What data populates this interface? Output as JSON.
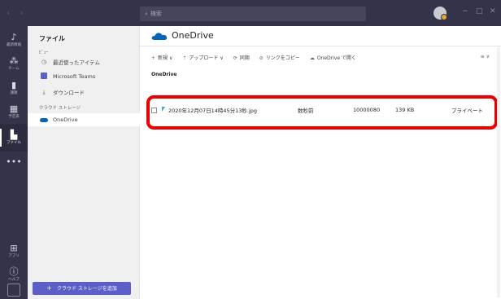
{
  "titlebar": {
    "search_placeholder": "検索",
    "back_glyph": "‹",
    "forward_glyph": "›",
    "minimize_glyph": "−",
    "restore_glyph": "□",
    "close_glyph": "✕"
  },
  "rail": {
    "items": [
      {
        "label": "最新情報",
        "icon": "bell-icon",
        "glyph": "🔔"
      },
      {
        "label": "チーム",
        "icon": "teams-icon",
        "glyph": "👥"
      },
      {
        "label": "課題",
        "icon": "assignments-icon",
        "glyph": "📋"
      },
      {
        "label": "予定表",
        "icon": "calendar-icon",
        "glyph": "📅"
      },
      {
        "label": "ファイル",
        "icon": "files-icon",
        "glyph": "📄"
      },
      {
        "label": "",
        "icon": "more-icon",
        "glyph": "•••"
      },
      {
        "label": "アプリ",
        "icon": "apps-icon",
        "glyph": "⊞"
      },
      {
        "label": "ヘルプ",
        "icon": "help-icon",
        "glyph": "?"
      }
    ]
  },
  "leftpanel": {
    "title": "ファイル",
    "view_section": "ﾋﾞｭｰ",
    "recent": "最近使ったアイテム",
    "teams": "Microsoft Teams",
    "downloads": "ダウンロード",
    "cloud_section": "クラウド ストレージ",
    "onedrive": "OneDrive",
    "add_storage_label": "クラウド ストレージを追加"
  },
  "main": {
    "header_title": "OneDrive",
    "toolbar": {
      "new": "新規",
      "upload": "アップロード",
      "sync": "同期",
      "copy_link": "リンクをコピー",
      "open_onedrive": "OneDrive で開く",
      "view_icon": "≡ ∨"
    },
    "breadcrumb": "OneDrive",
    "files": [
      {
        "name": "2020年12月07日14時45分13秒.jpg",
        "modified_by": "数秒前",
        "owner": "10000080",
        "size": "139 KB",
        "sharing": "プライベート"
      }
    ]
  },
  "colors": {
    "titlebar": "#33344a",
    "accent": "#5b5fc7",
    "highlight": "#ea0000",
    "onedrive_blue": "#0364b8"
  }
}
